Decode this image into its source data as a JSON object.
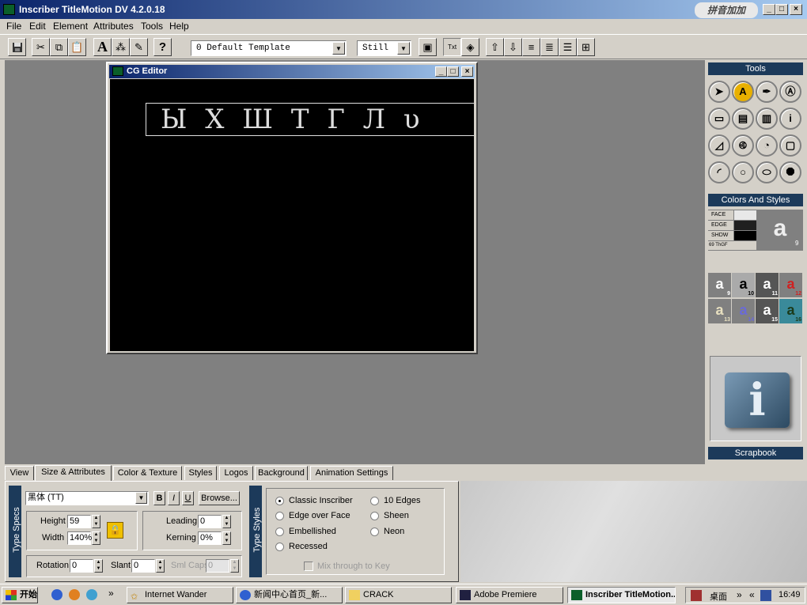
{
  "app": {
    "title": "Inscriber TitleMotion DV 4.2.0.18",
    "ime_label": "拼音加加"
  },
  "window_controls": {
    "minimize": "_",
    "maximize": "□",
    "close": "×"
  },
  "menu": [
    "File",
    "Edit",
    "Element",
    "Attributes",
    "Tools",
    "Help"
  ],
  "toolbar": {
    "template_value": "0  Default Template",
    "mode_value": "Still",
    "help_label": "?",
    "text_label": "A"
  },
  "cg_editor": {
    "title": "CG Editor",
    "canvas_text": "Ы Х Ш Т Г Л υ"
  },
  "tools_panel": {
    "title": "Tools",
    "colors_title": "Colors And Styles",
    "face_label": "FACE",
    "edge_label": "EDGE",
    "shadow_label": "SHDW",
    "style_num_label": "69 ThGF",
    "preview_char": "a",
    "preview_num": "9",
    "scrapbook_title": "Scrapbook",
    "style_tiles": [
      {
        "char": "a",
        "num": "9"
      },
      {
        "char": "a",
        "num": "10"
      },
      {
        "char": "a",
        "num": "11"
      },
      {
        "char": "a",
        "num": "12"
      },
      {
        "char": "a",
        "num": "13"
      },
      {
        "char": "a",
        "num": "14"
      },
      {
        "char": "a",
        "num": "15"
      },
      {
        "char": "a",
        "num": "16"
      }
    ],
    "colors": {
      "face": "#e8e8e8",
      "edge": "#202020",
      "shadow": "#000000",
      "accent": "#1c3a5a"
    }
  },
  "tabs": [
    "View",
    "Size & Attributes",
    "Color & Texture",
    "Styles",
    "Logos",
    "Background",
    "Animation Settings"
  ],
  "active_tab": "Size & Attributes",
  "type_specs": {
    "section_label": "Type Specs",
    "font_value": "黑体 (TT)",
    "bold_label": "B",
    "italic_label": "I",
    "underline_label": "U",
    "browse_label": "Browse...",
    "height_label": "Height",
    "height_value": "59",
    "width_label": "Width",
    "width_value": "140%",
    "leading_label": "Leading",
    "leading_value": "0",
    "kerning_label": "Kerning",
    "kerning_value": "0%",
    "rotation_label": "Rotation",
    "rotation_value": "0",
    "slant_label": "Slant",
    "slant_value": "0",
    "smlcaps_label": "Sml Caps",
    "smlcaps_value": "0"
  },
  "type_styles": {
    "section_label": "Type Styles",
    "options": [
      {
        "label": "Classic Inscriber",
        "selected": true
      },
      {
        "label": "10 Edges",
        "selected": false
      },
      {
        "label": "Edge over Face",
        "selected": false
      },
      {
        "label": "Sheen",
        "selected": false
      },
      {
        "label": "Embellished",
        "selected": false
      },
      {
        "label": "Neon",
        "selected": false
      },
      {
        "label": "Recessed",
        "selected": false
      }
    ],
    "mix_label": "Mix through to Key"
  },
  "taskbar": {
    "start_label": "开始",
    "quick_more": "»",
    "tasks": [
      "Internet Wander",
      "新闻中心首页_新...",
      "CRACK",
      "Adobe Premiere",
      "Inscriber TitleMotion..."
    ],
    "desktop_label": "桌面",
    "tray_more": "«",
    "clock": "16:49"
  }
}
